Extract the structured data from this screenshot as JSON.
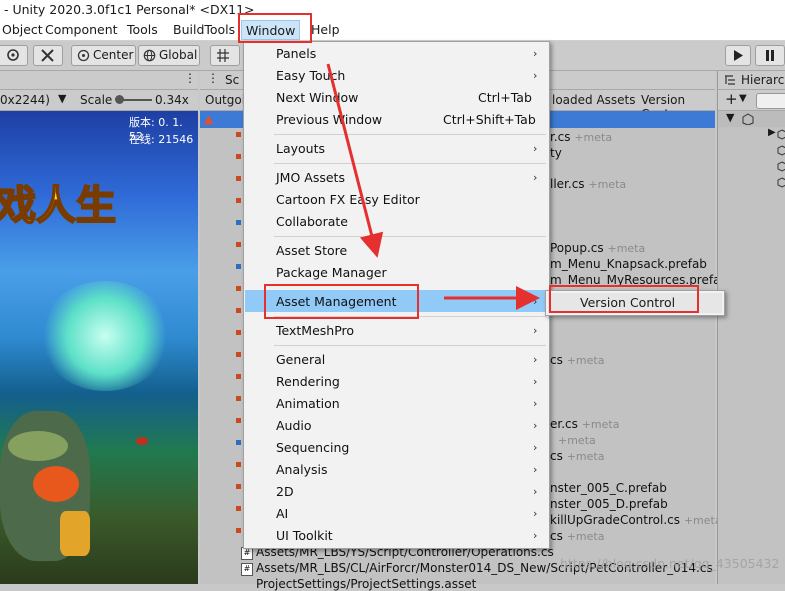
{
  "window_title": "- Unity 2020.3.0f1c1 Personal* <DX11>",
  "menubar": [
    "Object",
    "Component",
    "Tools",
    "BuildTools",
    "Window",
    "Help"
  ],
  "toolbar": {
    "center_label": "Center",
    "global_label": "Global"
  },
  "game": {
    "resolution": "0x2244)",
    "scale_label": "Scale",
    "scale_value": "0.34x",
    "version_text": "版本: 0. 1. 52",
    "online_text": "在线: 21546",
    "logo_text": "戏人生"
  },
  "project": {
    "header": "Sc",
    "tabs": [
      "Outgoi",
      "loaded Assets",
      "Version Contr"
    ],
    "rows": [
      {
        "text": "r.cs",
        "meta": "+meta"
      },
      {
        "text": "ty",
        "meta": ""
      },
      {
        "text": "ller.cs",
        "meta": "+meta"
      },
      {
        "text": "Popup.cs",
        "meta": "+meta"
      },
      {
        "text": "m_Menu_Knapsack.prefab",
        "meta": ""
      },
      {
        "text": "m_Menu_MyResources.prefa",
        "meta": ""
      },
      {
        "text": "cs",
        "meta": "+meta"
      },
      {
        "text": "er.cs",
        "meta": "+meta"
      },
      {
        "text": "",
        "meta": "+meta"
      },
      {
        "text": "cs",
        "meta": "+meta"
      },
      {
        "text": "nster_005_C.prefab",
        "meta": ""
      },
      {
        "text": "nster_005_D.prefab",
        "meta": ""
      },
      {
        "text": "killUpGradeControl.cs",
        "meta": "+meta"
      },
      {
        "text": "cs",
        "meta": "+meta"
      }
    ],
    "bottom_rows": [
      "Assets/MR_LBS/YS/Script/Controller/Operations.cs",
      "Assets/MR_LBS/CL/AirForcr/Monster014_DS_New/Script/PetController_014.cs",
      "ProjectSettings/ProjectSettings.asset"
    ]
  },
  "hierarchy": {
    "title": "Hierarch"
  },
  "window_menu": {
    "items": [
      {
        "label": "Panels",
        "submenu": true
      },
      {
        "label": "Easy Touch",
        "submenu": true
      },
      {
        "label": "Next Window",
        "shortcut": "Ctrl+Tab"
      },
      {
        "label": "Previous Window",
        "shortcut": "Ctrl+Shift+Tab"
      },
      {
        "label": "Layouts",
        "submenu": true
      },
      {
        "label": "JMO Assets",
        "submenu": true
      },
      {
        "label": "Cartoon FX Easy Editor"
      },
      {
        "label": "Collaborate"
      },
      {
        "label": "Asset Store"
      },
      {
        "label": "Package Manager"
      },
      {
        "label": "Asset Management",
        "submenu": true
      },
      {
        "label": "TextMeshPro",
        "submenu": true
      },
      {
        "label": "General",
        "submenu": true
      },
      {
        "label": "Rendering",
        "submenu": true
      },
      {
        "label": "Animation",
        "submenu": true
      },
      {
        "label": "Audio",
        "submenu": true
      },
      {
        "label": "Sequencing",
        "submenu": true
      },
      {
        "label": "Analysis",
        "submenu": true
      },
      {
        "label": "2D",
        "submenu": true
      },
      {
        "label": "AI",
        "submenu": true
      },
      {
        "label": "UI Toolkit",
        "submenu": true
      }
    ],
    "submenu_item": "Version Control"
  },
  "watermark": "https://blog.csdn.net/qq_43505432",
  "colors": {
    "highlight": "#91c9f7",
    "annotation_red": "#e53030",
    "selection_blue": "#3d7ad5"
  }
}
